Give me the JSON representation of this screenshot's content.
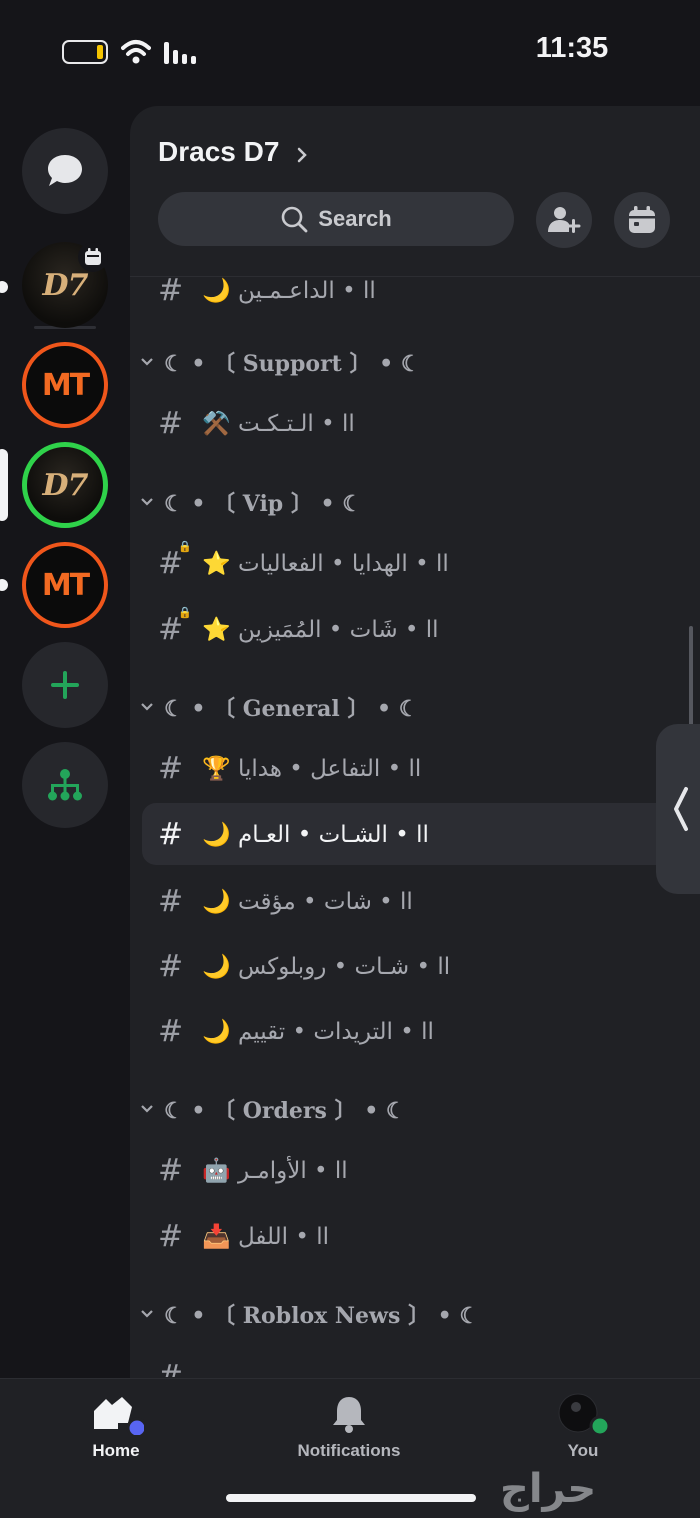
{
  "status_bar": {
    "time": "11:35"
  },
  "rail": {
    "direct_messages_icon": "chat-bubble-icon",
    "servers": [
      {
        "label": "D7"
      },
      {
        "label": "MT"
      },
      {
        "label": "D7"
      },
      {
        "label": "MT"
      }
    ],
    "add_server_icon": "plus-icon",
    "discover_icon": "hierarchy-icon"
  },
  "server": {
    "name": "Dracs D7",
    "search_placeholder": "Search"
  },
  "channels": {
    "partial_top": {
      "hash": "#",
      "name": "🌙 اا • الداعـمـين"
    },
    "categories": [
      {
        "label": "☾ • 〔 Support 〕 • ☾",
        "channels": [
          {
            "hash": "#",
            "name": "⚒️ اا • الـتـكـت"
          }
        ]
      },
      {
        "label": "☾ • 〔 Vip 〕 • ☾",
        "channels": [
          {
            "hash": "#",
            "name": "⭐ اا • الهدايا • الفعاليات",
            "locked": true
          },
          {
            "hash": "#",
            "name": "⭐ اا • شَات • المُمَيزين",
            "locked": true
          }
        ]
      },
      {
        "label": "☾ • 〔 General 〕 • ☾",
        "channels": [
          {
            "hash": "#",
            "name": "🏆 اا • التفاعل • هدايا"
          },
          {
            "hash": "#",
            "name": "🌙 اا • الشـات • العـام",
            "selected": true
          },
          {
            "hash": "#",
            "name": "🌙 اا • شات • مؤقت"
          },
          {
            "hash": "#",
            "name": "🌙 اا • شـات • روبلوكس"
          },
          {
            "hash": "#",
            "name": "🌙 اا • التريدات • تقييم"
          }
        ]
      },
      {
        "label": "☾ • 〔 Orders 〕 • ☾",
        "channels": [
          {
            "hash": "#",
            "name": "🤖 اا • الأوامـر"
          },
          {
            "hash": "#",
            "name": "📥 اا • اللفل"
          }
        ]
      },
      {
        "label": "☾ • 〔 Roblox News 〕 • ☾",
        "channels": [
          {
            "hash": "#",
            "name": ""
          }
        ]
      }
    ]
  },
  "tabbar": {
    "home": "Home",
    "notifications": "Notifications",
    "you": "You"
  },
  "watermark": "حراج",
  "colors": {
    "accent_blurple": "#5865f2",
    "online_green": "#23a55a",
    "server_ring_green": "#2fd24a",
    "mt_orange": "#f0561b"
  }
}
